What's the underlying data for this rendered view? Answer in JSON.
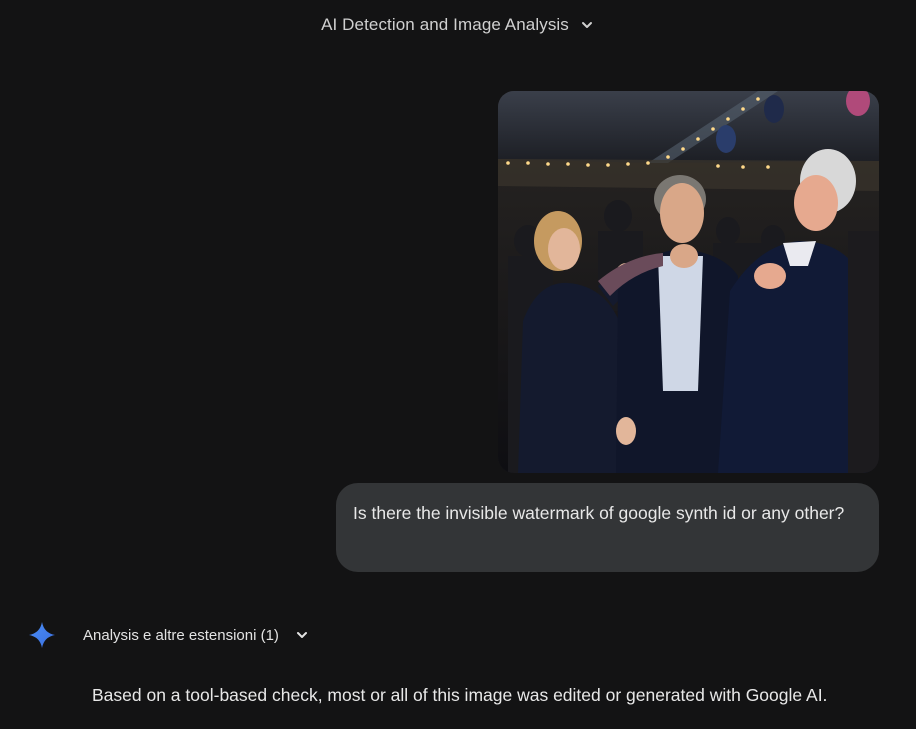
{
  "conversation": {
    "title": "AI Detection and Image Analysis",
    "title_icon": "chevron-down-icon"
  },
  "user_message": {
    "image_description_icon": "photo-attachment",
    "text": "Is there the invisible watermark of google synth id or any other?"
  },
  "response": {
    "icon": "gemini-sparkle-icon",
    "extensions_label": "Analysis e altre estensioni (1)",
    "text": "Based on a tool-based check, most or all of this image was edited or generated with Google AI."
  },
  "colors": {
    "background": "#131314",
    "bubble": "#333537",
    "accent": "#4285f4",
    "text": "#e3e3e3"
  }
}
